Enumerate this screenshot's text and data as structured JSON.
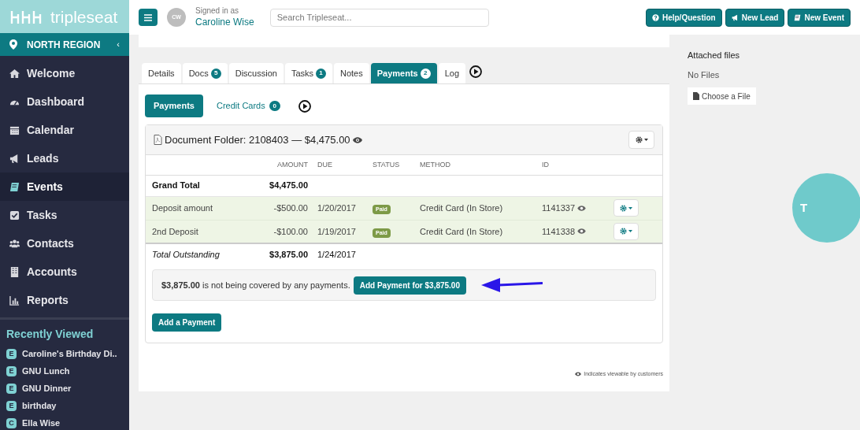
{
  "brand": "tripleseat",
  "region": "NORTH REGION",
  "collapse": "‹",
  "nav": [
    {
      "label": "Welcome",
      "selected": false
    },
    {
      "label": "Dashboard",
      "selected": false
    },
    {
      "label": "Calendar",
      "selected": false
    },
    {
      "label": "Leads",
      "selected": false
    },
    {
      "label": "Events",
      "selected": true
    },
    {
      "label": "Tasks",
      "selected": false
    },
    {
      "label": "Contacts",
      "selected": false
    },
    {
      "label": "Accounts",
      "selected": false
    },
    {
      "label": "Reports",
      "selected": false
    }
  ],
  "recently_viewed": {
    "title": "Recently Viewed",
    "items": [
      {
        "badge": "E",
        "label": "Caroline's Birthday Di.."
      },
      {
        "badge": "E",
        "label": "GNU Lunch"
      },
      {
        "badge": "E",
        "label": "GNU Dinner"
      },
      {
        "badge": "E",
        "label": "birthday"
      },
      {
        "badge": "C",
        "label": "Ella Wise"
      }
    ]
  },
  "user": {
    "initials": "CW",
    "signed_in_label": "Signed in as",
    "name": "Caroline Wise"
  },
  "search": {
    "placeholder": "Search Tripleseat..."
  },
  "top_buttons": [
    {
      "label": "Help/Question"
    },
    {
      "label": "New Lead"
    },
    {
      "label": "New Event"
    }
  ],
  "tabs": [
    {
      "label": "Details",
      "selected": false
    },
    {
      "label": "Docs",
      "count": "5",
      "selected": false
    },
    {
      "label": "Discussion",
      "selected": false
    },
    {
      "label": "Tasks",
      "count": "1",
      "selected": false
    },
    {
      "label": "Notes",
      "selected": false
    },
    {
      "label": "Payments",
      "count": "2",
      "selected": true
    },
    {
      "label": "Log",
      "selected": false
    }
  ],
  "subtabs": [
    {
      "label": "Payments",
      "selected": true
    },
    {
      "label": "Credit Cards",
      "count": "0",
      "selected": false
    }
  ],
  "folder": {
    "title": "Document Folder: 2108403 — $4,475.00"
  },
  "table": {
    "columns": [
      "AMOUNT",
      "DUE",
      "STATUS",
      "METHOD",
      "ID"
    ],
    "rows": [
      {
        "kind": "total",
        "name": "Grand Total",
        "amount": "$4,475.00"
      },
      {
        "kind": "payment",
        "name": "Deposit amount",
        "amount": "-$500.00",
        "due": "1/20/2017",
        "status": "Paid",
        "method": "Credit Card (In Store)",
        "id": "1141337"
      },
      {
        "kind": "payment",
        "name": "2nd Deposit",
        "amount": "-$100.00",
        "due": "1/19/2017",
        "status": "Paid",
        "method": "Credit Card (In Store)",
        "id": "1141338"
      },
      {
        "kind": "outstanding",
        "name": "Total Outstanding",
        "amount": "$3,875.00",
        "due": "1/24/2017"
      }
    ]
  },
  "notice": {
    "text": "**$3,875.00** is not being covered by any payments.",
    "button": "Add Payment for $3,875.00"
  },
  "add_button": "Add a Payment",
  "footnote": "Indicates viewable by customers",
  "attachments": {
    "title": "Attached files",
    "empty": "No Files",
    "button": "Choose a File"
  },
  "widget": {
    "label": "T"
  }
}
